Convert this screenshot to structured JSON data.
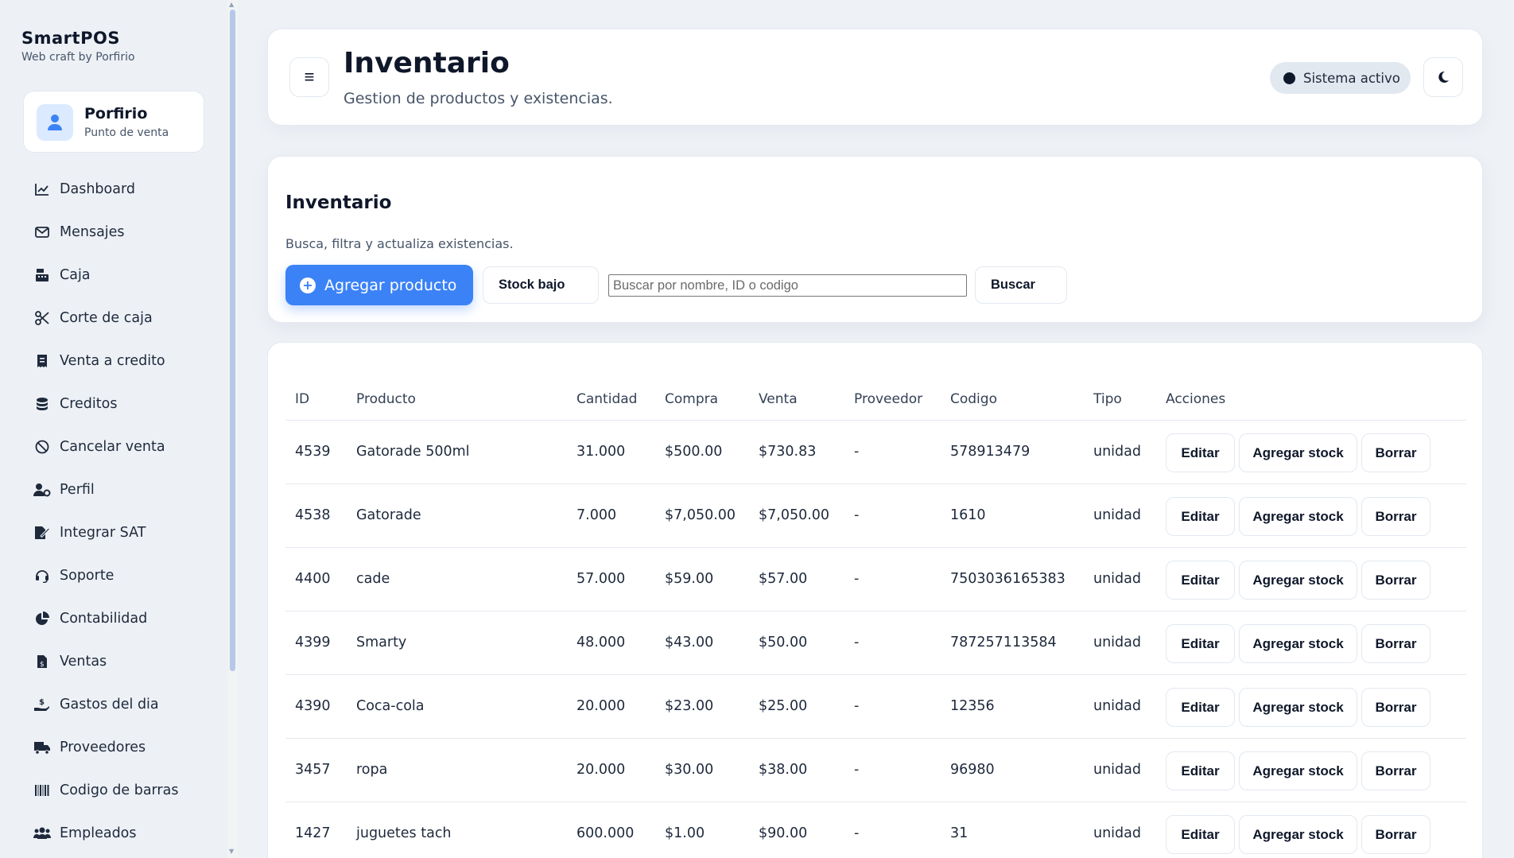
{
  "brand": {
    "title": "SmartPOS",
    "subtitle": "Web craft by Porfirio"
  },
  "user": {
    "name": "Porfirio",
    "role": "Punto de venta"
  },
  "nav": [
    {
      "label": "Dashboard",
      "icon": "chart-line-icon"
    },
    {
      "label": "Mensajes",
      "icon": "envelope-icon"
    },
    {
      "label": "Caja",
      "icon": "cash-register-icon"
    },
    {
      "label": "Corte de caja",
      "icon": "scissors-icon"
    },
    {
      "label": "Venta a credito",
      "icon": "receipt-icon"
    },
    {
      "label": "Creditos",
      "icon": "coins-icon"
    },
    {
      "label": "Cancelar venta",
      "icon": "ban-icon"
    },
    {
      "label": "Perfil",
      "icon": "user-gear-icon"
    },
    {
      "label": "Integrar SAT",
      "icon": "file-signature-icon"
    },
    {
      "label": "Soporte",
      "icon": "headset-icon"
    },
    {
      "label": "Contabilidad",
      "icon": "chart-pie-icon"
    },
    {
      "label": "Ventas",
      "icon": "file-invoice-dollar-icon"
    },
    {
      "label": "Gastos del dia",
      "icon": "hand-holding-dollar-icon"
    },
    {
      "label": "Proveedores",
      "icon": "truck-icon"
    },
    {
      "label": "Codigo de barras",
      "icon": "barcode-icon"
    },
    {
      "label": "Empleados",
      "icon": "users-icon"
    }
  ],
  "header": {
    "title": "Inventario",
    "subtitle": "Gestion de productos y existencias.",
    "status": "Sistema activo"
  },
  "filter": {
    "title": "Inventario",
    "subtitle": "Busca, filtra y actualiza existencias.",
    "add_label": "Agregar producto",
    "low_stock_label": "Stock bajo",
    "search_placeholder": "Buscar por nombre, ID o codigo",
    "search_value": "",
    "search_button": "Buscar"
  },
  "table": {
    "headers": [
      "ID",
      "Producto",
      "Cantidad",
      "Compra",
      "Venta",
      "Proveedor",
      "Codigo",
      "Tipo",
      "Acciones"
    ],
    "actions": {
      "edit": "Editar",
      "add_stock": "Agregar stock",
      "delete": "Borrar"
    },
    "rows": [
      {
        "id": "4539",
        "producto": "Gatorade 500ml",
        "cantidad": "31.000",
        "compra": "$500.00",
        "venta": "$730.83",
        "proveedor": "-",
        "codigo": "578913479",
        "tipo": "unidad"
      },
      {
        "id": "4538",
        "producto": "Gatorade",
        "cantidad": "7.000",
        "compra": "$7,050.00",
        "venta": "$7,050.00",
        "proveedor": "-",
        "codigo": "1610",
        "tipo": "unidad"
      },
      {
        "id": "4400",
        "producto": "cade",
        "cantidad": "57.000",
        "compra": "$59.00",
        "venta": "$57.00",
        "proveedor": "-",
        "codigo": "7503036165383",
        "tipo": "unidad"
      },
      {
        "id": "4399",
        "producto": "Smarty",
        "cantidad": "48.000",
        "compra": "$43.00",
        "venta": "$50.00",
        "proveedor": "-",
        "codigo": "787257113584",
        "tipo": "unidad"
      },
      {
        "id": "4390",
        "producto": "Coca-cola",
        "cantidad": "20.000",
        "compra": "$23.00",
        "venta": "$25.00",
        "proveedor": "-",
        "codigo": "12356",
        "tipo": "unidad"
      },
      {
        "id": "3457",
        "producto": "ropa",
        "cantidad": "20.000",
        "compra": "$30.00",
        "venta": "$38.00",
        "proveedor": "-",
        "codigo": "96980",
        "tipo": "unidad"
      },
      {
        "id": "1427",
        "producto": "juguetes tach",
        "cantidad": "600.000",
        "compra": "$1.00",
        "venta": "$90.00",
        "proveedor": "-",
        "codigo": "31",
        "tipo": "unidad"
      }
    ]
  },
  "colors": {
    "accent": "#3b82f6",
    "background": "#eef2f7",
    "text": "#0f172a"
  }
}
